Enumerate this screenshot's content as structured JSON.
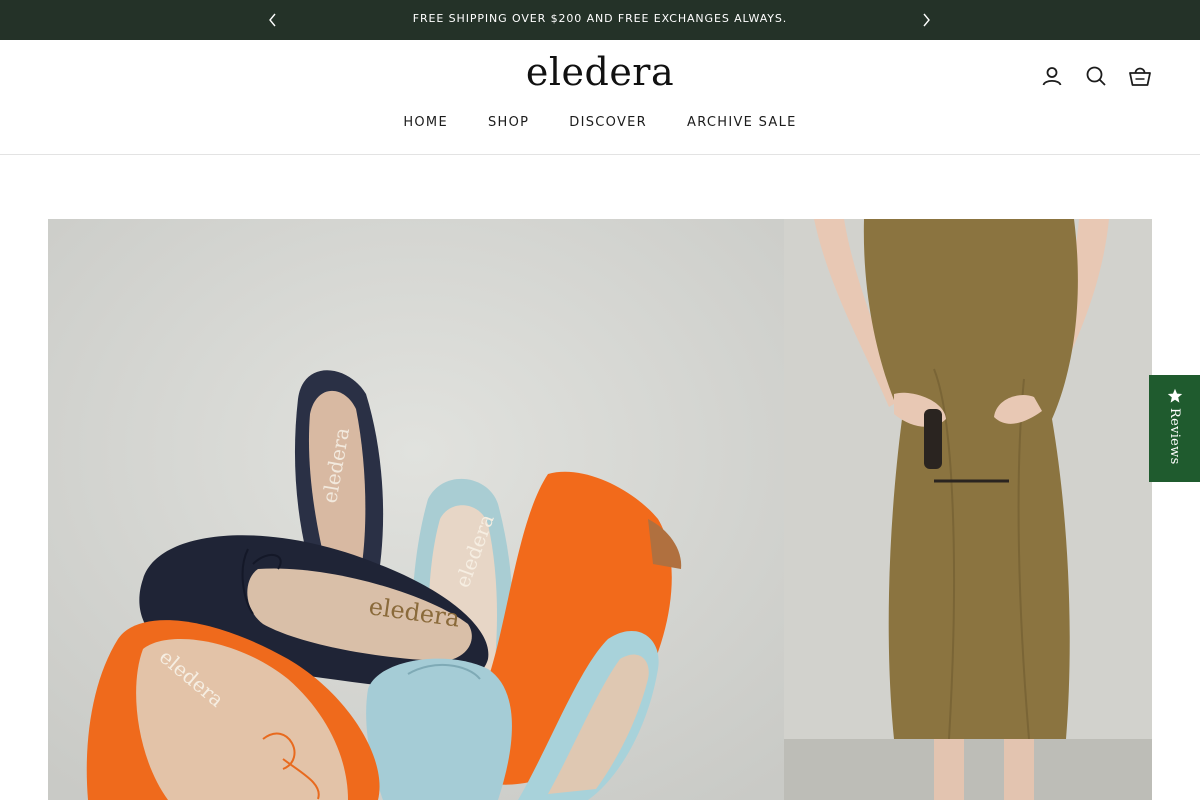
{
  "announcement": {
    "message": "FREE SHIPPING OVER $200 AND FREE EXCHANGES ALWAYS.",
    "prev_icon": "chevron-left-icon",
    "next_icon": "chevron-right-icon"
  },
  "header": {
    "logo": "eledera",
    "icons": [
      "account-icon",
      "search-icon",
      "cart-icon"
    ]
  },
  "nav": {
    "items": [
      {
        "label": "HOME"
      },
      {
        "label": "SHOP"
      },
      {
        "label": "DISCOVER"
      },
      {
        "label": "ARCHIVE SALE"
      }
    ]
  },
  "hero": {
    "left_image": "ballet-flats-photo",
    "right_image": "model-olive-skirt-photo",
    "shoe_brand_print": "eledera"
  },
  "reviews_tab": {
    "label": "Reviews",
    "icon": "star-icon"
  },
  "colors": {
    "announcement_bg": "#243228",
    "reviews_bg": "#1f5b2e",
    "text": "#1c1c1c"
  }
}
